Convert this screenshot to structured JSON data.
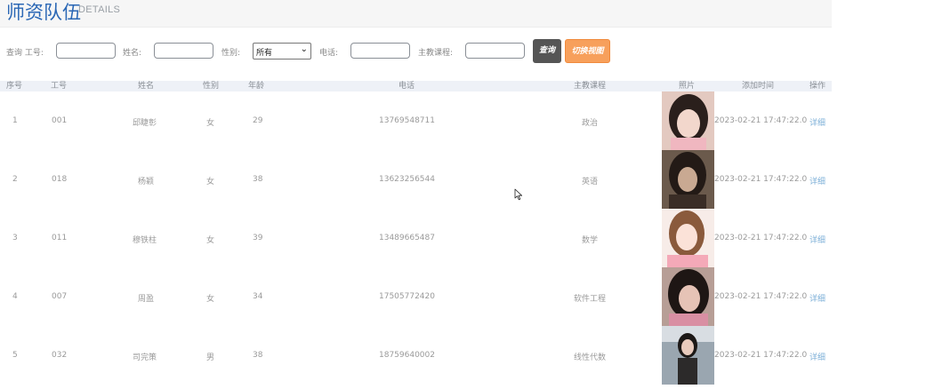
{
  "header": {
    "title": "师资队伍",
    "subtitle": "DETAILS"
  },
  "search": {
    "query_label": "查询 工号:",
    "name_label": "姓名:",
    "gender_label": "性别:",
    "gender_value": "所有",
    "phone_label": "电话:",
    "course_label": "主教课程:",
    "search_button": "查询",
    "switch_button": "切换视图"
  },
  "table": {
    "headers": [
      "序号",
      "工号",
      "姓名",
      "性别",
      "年龄",
      "电话",
      "主教课程",
      "照片",
      "添加时间",
      "操作"
    ],
    "rows": [
      {
        "no": "1",
        "id": "001",
        "name": "邱睫彰",
        "gender": "女",
        "age": "29",
        "phone": "13769548711",
        "course": "政治",
        "time": "2023-02-21 17:47:22.0",
        "action": "详细",
        "photo": "portrait-1"
      },
      {
        "no": "2",
        "id": "018",
        "name": "杨颖",
        "gender": "女",
        "age": "38",
        "phone": "13623256544",
        "course": "英语",
        "time": "2023-02-21 17:47:22.0",
        "action": "详细",
        "photo": "portrait-2"
      },
      {
        "no": "3",
        "id": "011",
        "name": "穆铁柱",
        "gender": "女",
        "age": "39",
        "phone": "13489665487",
        "course": "数学",
        "time": "2023-02-21 17:47:22.0",
        "action": "详细",
        "photo": "portrait-3"
      },
      {
        "no": "4",
        "id": "007",
        "name": "周盈",
        "gender": "女",
        "age": "34",
        "phone": "17505772420",
        "course": "软件工程",
        "time": "2023-02-21 17:47:22.0",
        "action": "详细",
        "photo": "portrait-4"
      },
      {
        "no": "5",
        "id": "032",
        "name": "司完策",
        "gender": "男",
        "age": "38",
        "phone": "18759640002",
        "course": "线性代数",
        "time": "2023-02-21 17:47:22.0",
        "action": "详细",
        "photo": "portrait-5"
      }
    ]
  }
}
